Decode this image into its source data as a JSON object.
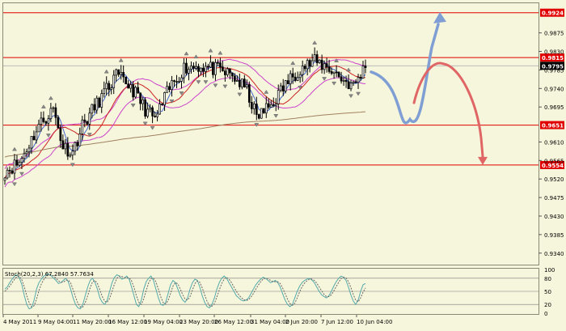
{
  "chart_data": [
    {
      "type": "candlestick",
      "title": "",
      "y_axis_ticks": [
        0.9875,
        0.983,
        0.9785,
        0.974,
        0.9695,
        0.961,
        0.9565,
        0.952,
        0.9475,
        0.943,
        0.9385,
        0.934
      ],
      "ylim": [
        0.9312,
        0.9947
      ],
      "x_axis_ticks": [
        "4 May 2011",
        "9 May 04:00",
        "11 May 20:00",
        "16 May 12:00",
        "19 May 04:00",
        "23 May 20:00",
        "26 May 12:00",
        "31 May 04:00",
        "2 Jun 20:00",
        "7 Jun 12:00",
        "10 Jun 04:00"
      ],
      "horizontal_levels": [
        {
          "value": 0.9924,
          "label": "0.9924",
          "color": "#e00000"
        },
        {
          "value": 0.9815,
          "label": "0.9815",
          "color": "#e00000"
        },
        {
          "value": 0.9651,
          "label": "0.9651",
          "color": "#e00000"
        },
        {
          "value": 0.9554,
          "label": "0.9554",
          "color": "#e00000"
        }
      ],
      "current_price": {
        "value": 0.9795,
        "label": "0.9795",
        "color": "#000000"
      },
      "forecast_arrows": [
        {
          "name": "bullish-scenario",
          "color": "#7f9fd4",
          "points": [
            [
              0.978
            ],
            [
              0.9665
            ],
            [
              0.9896
            ]
          ],
          "target": 0.991
        },
        {
          "name": "bearish-scenario",
          "color": "#e06666",
          "points": [
            [
              0.9705
            ],
            [
              0.9801
            ],
            [
              0.9554
            ]
          ],
          "target": 0.9554
        }
      ],
      "overlays": [
        "moving-average-short",
        "moving-average-mid",
        "moving-average-long",
        "envelope-upper",
        "envelope-lower",
        "fractal-markers"
      ],
      "colors": {
        "background": "#f6f6dc",
        "candle": "#000000",
        "level_line": "#e00000",
        "ma_mid": "#cc2222",
        "ma_long": "#a08060",
        "envelope": "#cc44cc",
        "ma_short": "#4466cc"
      }
    },
    {
      "type": "line",
      "title": "Stoch(20,2,3) 67.2840 57.7634",
      "y_axis_ticks": [
        100,
        80,
        50,
        20,
        0
      ],
      "ylim": [
        0,
        100
      ],
      "levels": [
        80,
        50,
        20
      ],
      "series": [
        {
          "name": "main",
          "style": "solid",
          "color": "#55aaaa",
          "values": [
            55,
            60,
            70,
            78,
            85,
            88,
            80,
            65,
            40,
            20,
            10,
            12,
            30,
            55,
            70,
            78,
            85,
            88,
            90,
            86,
            80,
            75,
            68,
            70,
            75,
            80,
            72,
            55,
            35,
            20,
            12,
            10,
            20,
            40,
            60,
            75,
            80,
            70,
            55,
            35,
            25,
            20,
            30,
            50,
            70,
            82,
            88,
            85,
            78,
            80,
            85,
            78,
            60,
            40,
            20,
            15,
            30,
            55,
            72,
            80,
            85,
            75,
            55,
            35,
            20,
            18,
            25,
            45,
            65,
            75,
            70,
            55,
            40,
            30,
            25,
            35,
            55,
            70,
            78,
            75,
            60,
            40,
            25,
            15,
            12,
            20,
            35,
            55,
            70,
            80,
            85,
            80,
            70,
            60,
            50,
            40,
            35,
            30,
            28,
            30,
            35,
            45,
            55,
            65,
            72,
            78,
            82,
            80,
            75,
            70,
            72,
            75,
            70,
            60,
            45,
            30,
            20,
            15,
            20,
            35,
            50,
            62,
            70,
            75,
            78,
            80,
            76,
            70,
            60,
            50,
            42,
            38,
            35,
            40,
            50,
            62,
            72,
            80,
            85,
            82,
            75,
            60,
            42,
            28,
            20,
            30,
            50,
            65,
            68
          ]
        },
        {
          "name": "signal",
          "style": "dashed",
          "color": "#666666",
          "values": [
            50,
            55,
            62,
            70,
            78,
            84,
            84,
            76,
            60,
            40,
            24,
            14,
            17,
            32,
            52,
            67,
            77,
            84,
            88,
            88,
            85,
            80,
            74,
            71,
            71,
            75,
            76,
            69,
            54,
            37,
            22,
            14,
            14,
            24,
            40,
            58,
            72,
            75,
            68,
            53,
            38,
            27,
            25,
            34,
            50,
            67,
            80,
            85,
            84,
            81,
            81,
            81,
            74,
            59,
            40,
            25,
            20,
            33,
            52,
            69,
            79,
            80,
            72,
            55,
            37,
            24,
            21,
            29,
            45,
            62,
            70,
            67,
            55,
            42,
            32,
            30,
            38,
            53,
            68,
            74,
            71,
            58,
            42,
            27,
            17,
            16,
            22,
            37,
            53,
            68,
            78,
            82,
            78,
            70,
            60,
            50,
            42,
            36,
            31,
            29,
            31,
            37,
            45,
            55,
            64,
            72,
            78,
            80,
            79,
            75,
            72,
            72,
            72,
            68,
            58,
            45,
            32,
            22,
            18,
            23,
            35,
            49,
            61,
            69,
            74,
            78,
            78,
            75,
            69,
            60,
            51,
            43,
            38,
            38,
            42,
            51,
            61,
            71,
            79,
            82,
            81,
            72,
            59,
            43,
            30,
            26,
            35,
            48,
            58
          ]
        }
      ]
    }
  ],
  "main_scale": {
    "ticks": [
      "0.9875",
      "0.9830",
      "0.9785",
      "0.9740",
      "0.9695",
      "0.9610",
      "0.9565",
      "0.9520",
      "0.9475",
      "0.9430",
      "0.9385",
      "0.9340"
    ]
  },
  "sub_scale": {
    "ticks": [
      "100",
      "80",
      "50",
      "20",
      "0"
    ]
  },
  "time_axis": {
    "labels": [
      "4 May 2011",
      "9 May 04:00",
      "11 May 20:00",
      "16 May 12:00",
      "19 May 04:00",
      "23 May 20:00",
      "26 May 12:00",
      "31 May 04:00",
      "2 Jun 20:00",
      "7 Jun 12:00",
      "10 Jun 04:00"
    ]
  },
  "level_labels": [
    "0.9924",
    "0.9815",
    "0.9651",
    "0.9554"
  ],
  "price_label": "0.9795",
  "stoch_title": "Stoch(20,2,3) 67.2840 57.7634"
}
